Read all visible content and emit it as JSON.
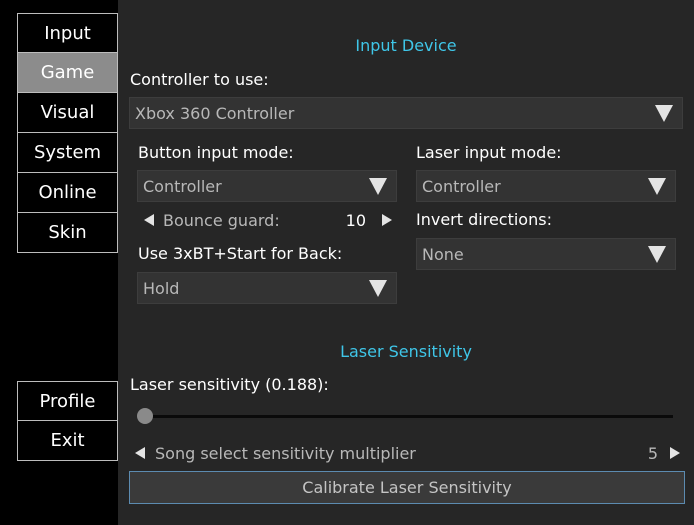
{
  "sidebar": {
    "top_items": [
      {
        "label": "Input",
        "active": false
      },
      {
        "label": "Game",
        "active": true
      },
      {
        "label": "Visual",
        "active": false
      },
      {
        "label": "System",
        "active": false
      },
      {
        "label": "Online",
        "active": false
      },
      {
        "label": "Skin",
        "active": false
      }
    ],
    "bottom_items": [
      {
        "label": "Profile"
      },
      {
        "label": "Exit"
      }
    ]
  },
  "input_device": {
    "title": "Input Device",
    "controller_label": "Controller to use:",
    "controller_value": "Xbox 360 Controller",
    "button_mode_label": "Button input mode:",
    "button_mode_value": "Controller",
    "laser_mode_label": "Laser input mode:",
    "laser_mode_value": "Controller",
    "bounce_guard_label": "Bounce guard:",
    "bounce_guard_value": "10",
    "invert_label": "Invert directions:",
    "invert_value": "None",
    "back_label": "Use 3xBT+Start for Back:",
    "back_value": "Hold"
  },
  "laser_sensitivity": {
    "title": "Laser Sensitivity",
    "sensitivity_label": "Laser sensitivity (0.188):",
    "slider_fraction": 0.0,
    "multiplier_label": "Song select sensitivity multiplier",
    "multiplier_value": "5",
    "calibrate_label": "Calibrate Laser Sensitivity"
  },
  "colors": {
    "accent": "#3fc6e8",
    "panel_bg": "#262626",
    "active_tab": "#8c8c8c"
  }
}
